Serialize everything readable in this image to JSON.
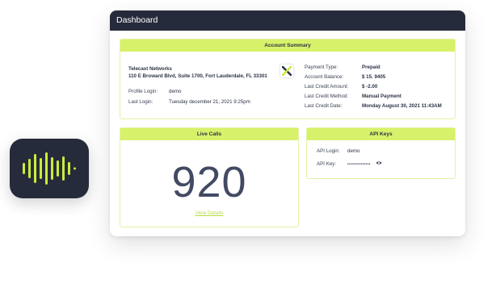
{
  "app_icon": {
    "icon": "audio-wave-icon",
    "color": "#c9ec3b"
  },
  "window": {
    "title": "Dashboard"
  },
  "account_summary": {
    "title": "Account Summary",
    "company_name": "Telecast Networks",
    "company_address": "110 E Broward Blvd, Suite 1700, Fort Lauderdale, FL 33301",
    "logo": "x-logo-icon",
    "profile_login_label": "Profile Login:",
    "profile_login_value": "demo",
    "last_login_label": "Last Login:",
    "last_login_value": "Tuesday december 21, 2021 9:25pm",
    "payment_type_label": "Payment Type:",
    "payment_type_value": "Prepaid",
    "account_balance_label": "Account Balance:",
    "account_balance_value": "$ 15. 9405",
    "last_credit_amount_label": "Last Credit Amount:",
    "last_credit_amount_value": "$ -2.00",
    "last_credit_method_label": "Last Credit Method:",
    "last_credit_method_value": "Manual Payment",
    "last_credit_date_label": "Last Credit Date:",
    "last_credit_date_value": "Monday August 30, 2021 11:43AM"
  },
  "live_calls": {
    "title": "Live Calls",
    "count": "920",
    "link": "View Details"
  },
  "api_keys": {
    "title": "API Keys",
    "login_label": "API Login:",
    "login_value": "demo",
    "key_label": "API Key:",
    "key_value": "••••••••••••••",
    "reveal_icon": "eye-icon"
  },
  "colors": {
    "accent": "#d7f26a",
    "dark": "#262b3b",
    "link": "#b7dc45"
  }
}
